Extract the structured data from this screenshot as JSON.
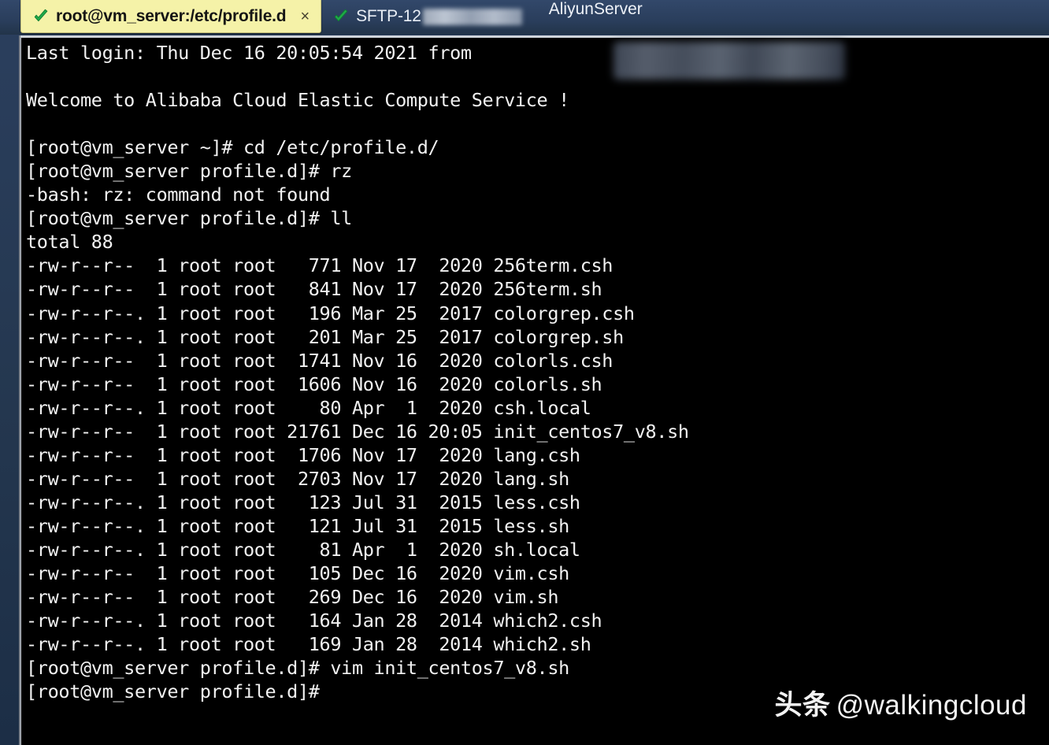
{
  "window": {
    "tabs": [
      {
        "id": "tab-ssh",
        "title": "root@vm_server:/etc/profile.d",
        "status_icon": "check-icon",
        "active": true,
        "close_label": "×"
      },
      {
        "id": "tab-sftp",
        "title_prefix": "SFTP-12",
        "title_redacted": true,
        "status_icon": "check-icon",
        "active": false
      }
    ],
    "server_label": "AliyunServer"
  },
  "terminal": {
    "lines": [
      "Last login: Thu Dec 16 20:05:54 2021 from",
      "",
      "Welcome to Alibaba Cloud Elastic Compute Service !",
      "",
      "[root@vm_server ~]# cd /etc/profile.d/",
      "[root@vm_server profile.d]# rz",
      "-bash: rz: command not found",
      "[root@vm_server profile.d]# ll",
      "total 88",
      "-rw-r--r--  1 root root   771 Nov 17  2020 256term.csh",
      "-rw-r--r--  1 root root   841 Nov 17  2020 256term.sh",
      "-rw-r--r--. 1 root root   196 Mar 25  2017 colorgrep.csh",
      "-rw-r--r--. 1 root root   201 Mar 25  2017 colorgrep.sh",
      "-rw-r--r--  1 root root  1741 Nov 16  2020 colorls.csh",
      "-rw-r--r--  1 root root  1606 Nov 16  2020 colorls.sh",
      "-rw-r--r--. 1 root root    80 Apr  1  2020 csh.local",
      "-rw-r--r--  1 root root 21761 Dec 16 20:05 init_centos7_v8.sh",
      "-rw-r--r--  1 root root  1706 Nov 17  2020 lang.csh",
      "-rw-r--r--  1 root root  2703 Nov 17  2020 lang.sh",
      "-rw-r--r--. 1 root root   123 Jul 31  2015 less.csh",
      "-rw-r--r--. 1 root root   121 Jul 31  2015 less.sh",
      "-rw-r--r--. 1 root root    81 Apr  1  2020 sh.local",
      "-rw-r--r--  1 root root   105 Dec 16  2020 vim.csh",
      "-rw-r--r--  1 root root   269 Dec 16  2020 vim.sh",
      "-rw-r--r--. 1 root root   164 Jan 28  2014 which2.csh",
      "-rw-r--r--. 1 root root   169 Jan 28  2014 which2.sh",
      "[root@vm_server profile.d]# vim init_centos7_v8.sh",
      "[root@vm_server profile.d]#"
    ],
    "directory_listing": {
      "total": "total 88",
      "columns": [
        "permissions",
        "links",
        "owner",
        "group",
        "size",
        "month",
        "day",
        "year_or_time",
        "name"
      ],
      "rows": [
        {
          "permissions": "-rw-r--r--",
          "links": "1",
          "owner": "root",
          "group": "root",
          "size": "771",
          "month": "Nov",
          "day": "17",
          "year_or_time": "2020",
          "name": "256term.csh"
        },
        {
          "permissions": "-rw-r--r--",
          "links": "1",
          "owner": "root",
          "group": "root",
          "size": "841",
          "month": "Nov",
          "day": "17",
          "year_or_time": "2020",
          "name": "256term.sh"
        },
        {
          "permissions": "-rw-r--r--.",
          "links": "1",
          "owner": "root",
          "group": "root",
          "size": "196",
          "month": "Mar",
          "day": "25",
          "year_or_time": "2017",
          "name": "colorgrep.csh"
        },
        {
          "permissions": "-rw-r--r--.",
          "links": "1",
          "owner": "root",
          "group": "root",
          "size": "201",
          "month": "Mar",
          "day": "25",
          "year_or_time": "2017",
          "name": "colorgrep.sh"
        },
        {
          "permissions": "-rw-r--r--",
          "links": "1",
          "owner": "root",
          "group": "root",
          "size": "1741",
          "month": "Nov",
          "day": "16",
          "year_or_time": "2020",
          "name": "colorls.csh"
        },
        {
          "permissions": "-rw-r--r--",
          "links": "1",
          "owner": "root",
          "group": "root",
          "size": "1606",
          "month": "Nov",
          "day": "16",
          "year_or_time": "2020",
          "name": "colorls.sh"
        },
        {
          "permissions": "-rw-r--r--.",
          "links": "1",
          "owner": "root",
          "group": "root",
          "size": "80",
          "month": "Apr",
          "day": "1",
          "year_or_time": "2020",
          "name": "csh.local"
        },
        {
          "permissions": "-rw-r--r--",
          "links": "1",
          "owner": "root",
          "group": "root",
          "size": "21761",
          "month": "Dec",
          "day": "16",
          "year_or_time": "20:05",
          "name": "init_centos7_v8.sh"
        },
        {
          "permissions": "-rw-r--r--",
          "links": "1",
          "owner": "root",
          "group": "root",
          "size": "1706",
          "month": "Nov",
          "day": "17",
          "year_or_time": "2020",
          "name": "lang.csh"
        },
        {
          "permissions": "-rw-r--r--",
          "links": "1",
          "owner": "root",
          "group": "root",
          "size": "2703",
          "month": "Nov",
          "day": "17",
          "year_or_time": "2020",
          "name": "lang.sh"
        },
        {
          "permissions": "-rw-r--r--.",
          "links": "1",
          "owner": "root",
          "group": "root",
          "size": "123",
          "month": "Jul",
          "day": "31",
          "year_or_time": "2015",
          "name": "less.csh"
        },
        {
          "permissions": "-rw-r--r--.",
          "links": "1",
          "owner": "root",
          "group": "root",
          "size": "121",
          "month": "Jul",
          "day": "31",
          "year_or_time": "2015",
          "name": "less.sh"
        },
        {
          "permissions": "-rw-r--r--.",
          "links": "1",
          "owner": "root",
          "group": "root",
          "size": "81",
          "month": "Apr",
          "day": "1",
          "year_or_time": "2020",
          "name": "sh.local"
        },
        {
          "permissions": "-rw-r--r--",
          "links": "1",
          "owner": "root",
          "group": "root",
          "size": "105",
          "month": "Dec",
          "day": "16",
          "year_or_time": "2020",
          "name": "vim.csh"
        },
        {
          "permissions": "-rw-r--r--",
          "links": "1",
          "owner": "root",
          "group": "root",
          "size": "269",
          "month": "Dec",
          "day": "16",
          "year_or_time": "2020",
          "name": "vim.sh"
        },
        {
          "permissions": "-rw-r--r--.",
          "links": "1",
          "owner": "root",
          "group": "root",
          "size": "164",
          "month": "Jan",
          "day": "28",
          "year_or_time": "2014",
          "name": "which2.csh"
        },
        {
          "permissions": "-rw-r--r--.",
          "links": "1",
          "owner": "root",
          "group": "root",
          "size": "169",
          "month": "Jan",
          "day": "28",
          "year_or_time": "2014",
          "name": "which2.sh"
        }
      ]
    }
  },
  "watermark": {
    "cn": "头条",
    "handle": "@walkingcloud"
  },
  "colors": {
    "tabbar_bg": "#2a3e5c",
    "active_tab_bg": "#f5f2a8",
    "terminal_bg": "#000000",
    "terminal_fg": "#f2f2f2",
    "check_green": "#22b14c"
  }
}
